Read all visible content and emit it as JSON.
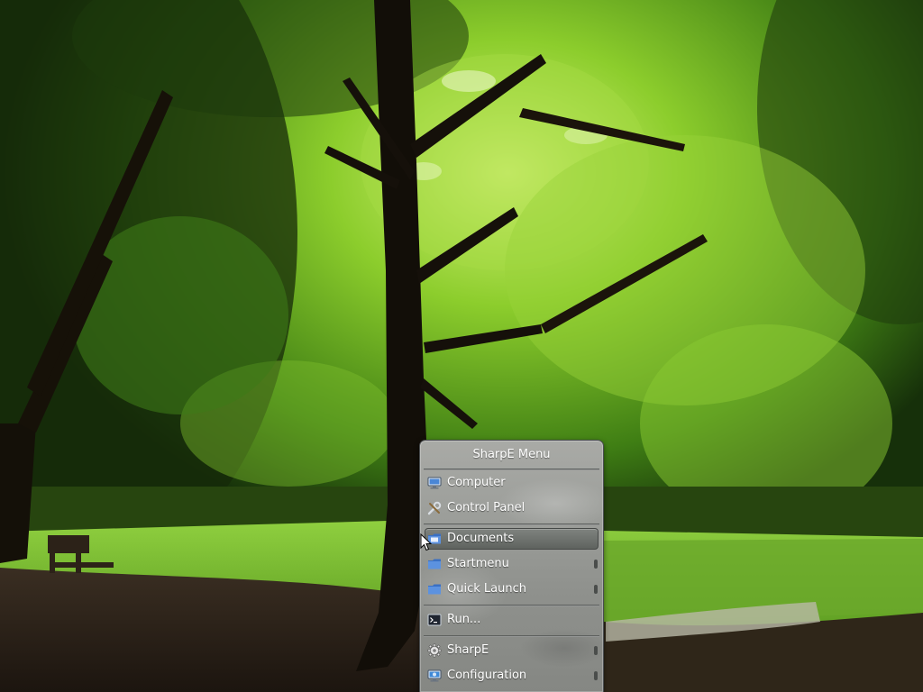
{
  "menu": {
    "title": "SharpE Menu",
    "items": [
      {
        "label": "Computer",
        "icon": "computer-icon",
        "has_submenu": false
      },
      {
        "label": "Control Panel",
        "icon": "tools-icon",
        "has_submenu": false
      },
      {
        "label": "Documents",
        "icon": "folder-icon",
        "has_submenu": true,
        "selected": true
      },
      {
        "label": "Startmenu",
        "icon": "folder-icon",
        "has_submenu": true
      },
      {
        "label": "Quick Launch",
        "icon": "folder-icon",
        "has_submenu": true
      },
      {
        "label": "Run...",
        "icon": "terminal-icon",
        "has_submenu": false
      },
      {
        "label": "SharpE",
        "icon": "gear-icon",
        "has_submenu": true
      },
      {
        "label": "Configuration",
        "icon": "monitor-settings-icon",
        "has_submenu": true
      }
    ]
  },
  "colors": {
    "menu_background": "#9c9e9a",
    "menu_selected": "#6f736f",
    "menu_text": "#ffffff",
    "folder_blue": "#4a7fd0"
  }
}
